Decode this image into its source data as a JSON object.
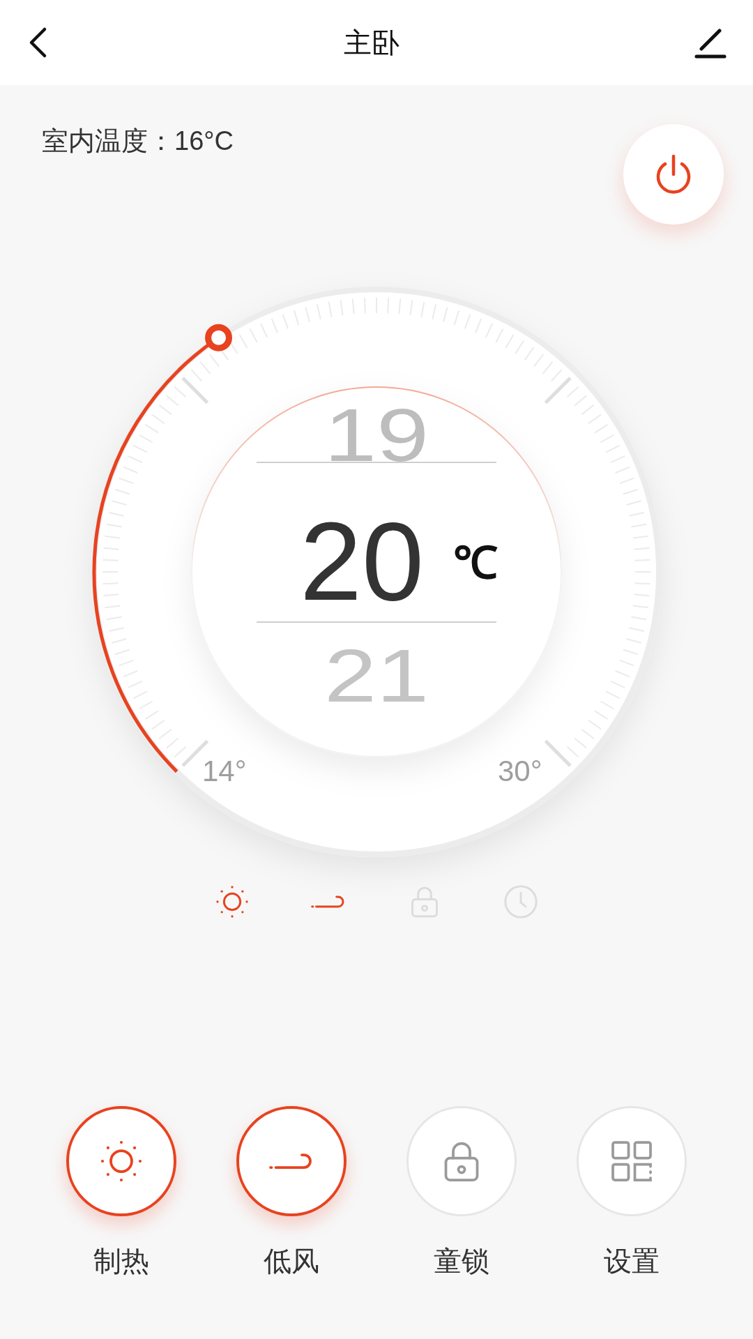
{
  "header": {
    "title": "主卧"
  },
  "indoor_temperature": "室内温度：16°C",
  "power": {
    "on": true
  },
  "dial": {
    "previous": "19",
    "current": "20",
    "unit": "℃",
    "next": "21",
    "min_label": "14°",
    "max_label": "30°"
  },
  "status_icons": [
    {
      "kind": "heat",
      "active": true
    },
    {
      "kind": "wind",
      "active": true
    },
    {
      "kind": "lock",
      "active": false
    },
    {
      "kind": "timer",
      "active": false
    }
  ],
  "buttons": [
    {
      "kind": "heat",
      "label": "制热",
      "active": true
    },
    {
      "kind": "wind",
      "label": "低风",
      "active": true
    },
    {
      "kind": "lock",
      "label": "童锁",
      "active": false
    },
    {
      "kind": "settings",
      "label": "设置",
      "active": false
    }
  ]
}
